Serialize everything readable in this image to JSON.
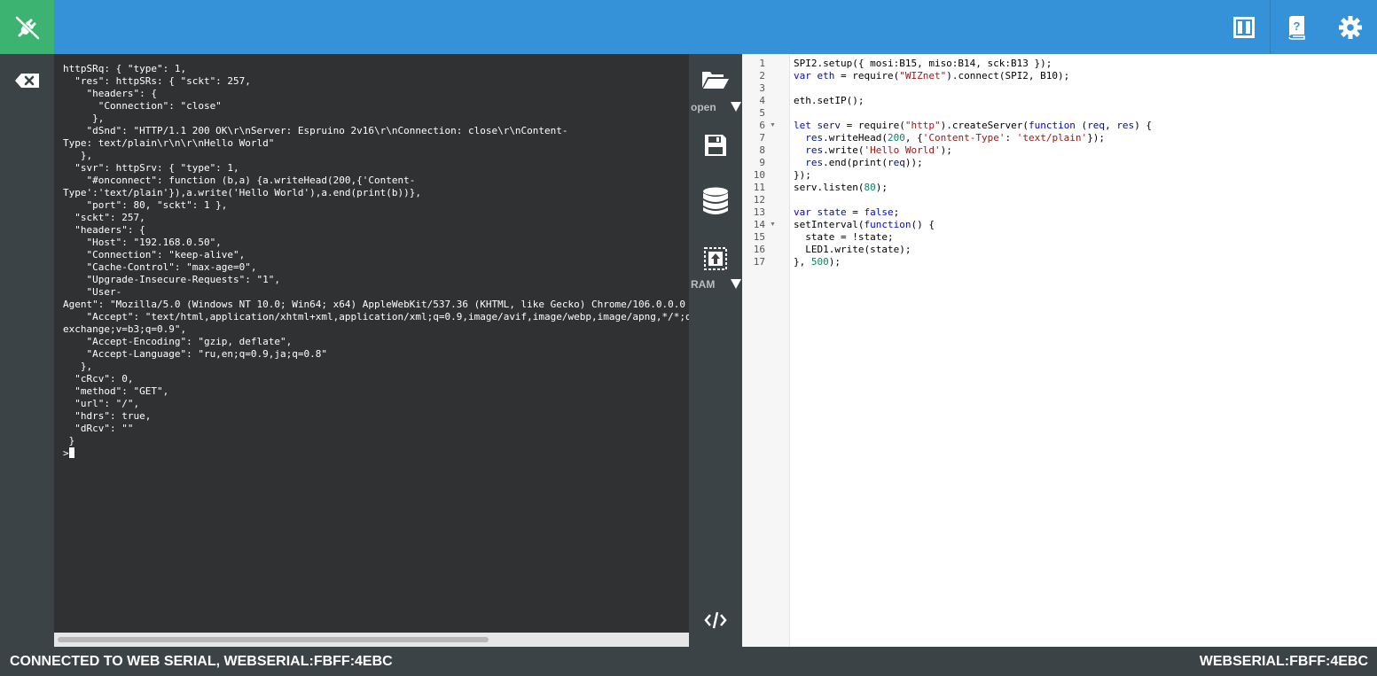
{
  "header": {
    "connect_icon": "plug-disconnect-icon",
    "layout_icon": "split-view-icon",
    "help_icon": "help-book-icon",
    "settings_icon": "gear-icon",
    "accent_color": "#3592d8",
    "connected_color": "#3cb371"
  },
  "terminal": {
    "clear_icon": "backspace-icon",
    "lines": [
      "httpSRq: { \"type\": 1,",
      "  \"res\": httpSRs: { \"sckt\": 257,",
      "    \"headers\": {",
      "      \"Connection\": \"close\"",
      "     },",
      "    \"dSnd\": \"HTTP/1.1 200 OK\\r\\nServer: Espruino 2v16\\r\\nConnection: close\\r\\nContent-",
      "Type: text/plain\\r\\n\\r\\nHello World\"",
      "   },",
      "  \"svr\": httpSrv: { \"type\": 1,",
      "    \"#onconnect\": function (b,a) {a.writeHead(200,{'Content-",
      "Type':'text/plain'}),a.write('Hello World'),a.end(print(b))},",
      "    \"port\": 80, \"sckt\": 1 },",
      "  \"sckt\": 257,",
      "  \"headers\": {",
      "    \"Host\": \"192.168.0.50\",",
      "    \"Connection\": \"keep-alive\",",
      "    \"Cache-Control\": \"max-age=0\",",
      "    \"Upgrade-Insecure-Requests\": \"1\",",
      "    \"User-",
      "Agent\": \"Mozilla/5.0 (Windows NT 10.0; Win64; x64) AppleWebKit/537.36 (KHTML, like Gecko) Chrome/106.0.0.0",
      "    \"Accept\": \"text/html,application/xhtml+xml,application/xml;q=0.9,image/avif,image/webp,image/apng,*/*;q",
      "exchange;v=b3;q=0.9\",",
      "    \"Accept-Encoding\": \"gzip, deflate\",",
      "    \"Accept-Language\": \"ru,en;q=0.9,ja;q=0.8\"",
      "   },",
      "  \"cRcv\": 0,",
      "  \"method\": \"GET\",",
      "  \"url\": \"/\",",
      "  \"hdrs\": true,",
      "  \"dRcv\": \"\"",
      " }"
    ],
    "prompt": ">"
  },
  "sidebar": {
    "open_icon": "folder-open-icon",
    "open_label": "open",
    "save_icon": "save-icon",
    "storage_icon": "database-icon",
    "upload_icon": "send-to-chip-icon",
    "upload_label": "RAM",
    "code_view_icon": "code-icon"
  },
  "editor": {
    "line_numbers": [
      "1",
      "2",
      "3",
      "4",
      "5",
      "6",
      "7",
      "8",
      "9",
      "10",
      "11",
      "12",
      "13",
      "14",
      "15",
      "16",
      "17"
    ],
    "code": {
      "l1": "SPI2.setup({ mosi:B15, miso:B14, sck:B13 });",
      "l2_kw": "var",
      "l2_var": "eth",
      "l2_a": " = require(",
      "l2_str": "\"WIZnet\"",
      "l2_b": ").connect(SPI2, B10);",
      "l4": "eth.setIP();",
      "l6_kw": "let",
      "l6_var": "serv",
      "l6_a": " = require(",
      "l6_str": "\"http\"",
      "l6_b": ").createServer(",
      "l6_kw2": "function",
      "l6_c": " (",
      "l6_p1": "req",
      "l6_d": ", ",
      "l6_p2": "res",
      "l6_e": ") {",
      "l7_var": "res",
      "l7_a": ".writeHead(",
      "l7_num": "200",
      "l7_b": ", {",
      "l7_str1": "'Content-Type'",
      "l7_c": ": ",
      "l7_str2": "'text/plain'",
      "l7_d": "});",
      "l8_var": "res",
      "l8_a": ".write(",
      "l8_str": "'Hello World'",
      "l8_b": ");",
      "l9_var": "res",
      "l9_a": ".end(print(",
      "l9_var2": "req",
      "l9_b": "));",
      "l10": "});",
      "l11_a": "serv.listen(",
      "l11_num": "80",
      "l11_b": ");",
      "l13_kw": "var",
      "l13_var": "state",
      "l13_a": " = ",
      "l13_kw2": "false",
      "l13_b": ";",
      "l14_a": "setInterval(",
      "l14_kw": "function",
      "l14_b": "() {",
      "l15": "  state = !state;",
      "l16": "  LED1.write(state);",
      "l17_a": "}, ",
      "l17_num": "500",
      "l17_b": ");"
    }
  },
  "status": {
    "left": "CONNECTED TO WEB SERIAL, WEBSERIAL:FBFF:4EBC",
    "right": "WEBSERIAL:FBFF:4EBC"
  }
}
